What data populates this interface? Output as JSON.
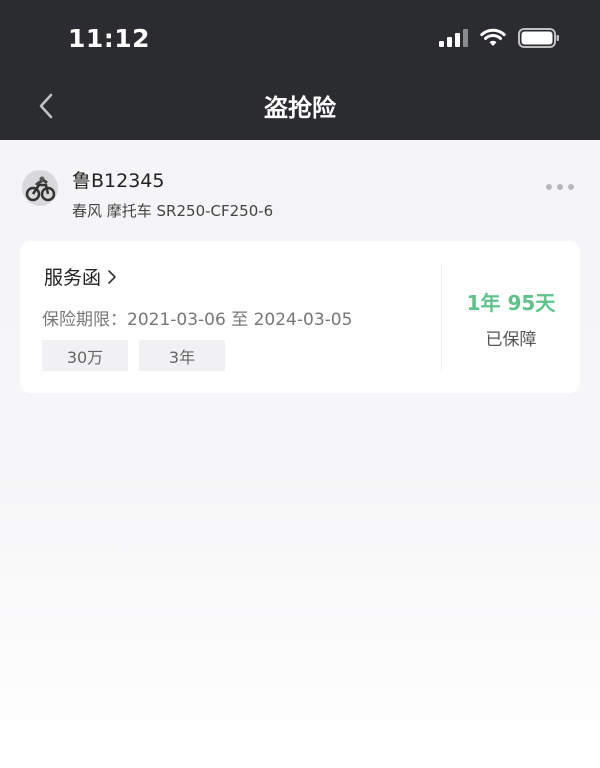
{
  "status_bar": {
    "time": "11:12"
  },
  "nav": {
    "title": "盗抢险"
  },
  "vehicle": {
    "plate": "鲁B12345",
    "model": "春风 摩托车 SR250-CF250-6"
  },
  "policy_card": {
    "title": "服务函",
    "period": "保险期限：2021-03-06 至 2024-03-05",
    "tags": [
      "30万",
      "3年"
    ],
    "remaining": "1年 95天",
    "remaining_label": "已保障"
  },
  "colors": {
    "header_bg": "#2b2c30",
    "accent_green": "#5cc48a"
  }
}
